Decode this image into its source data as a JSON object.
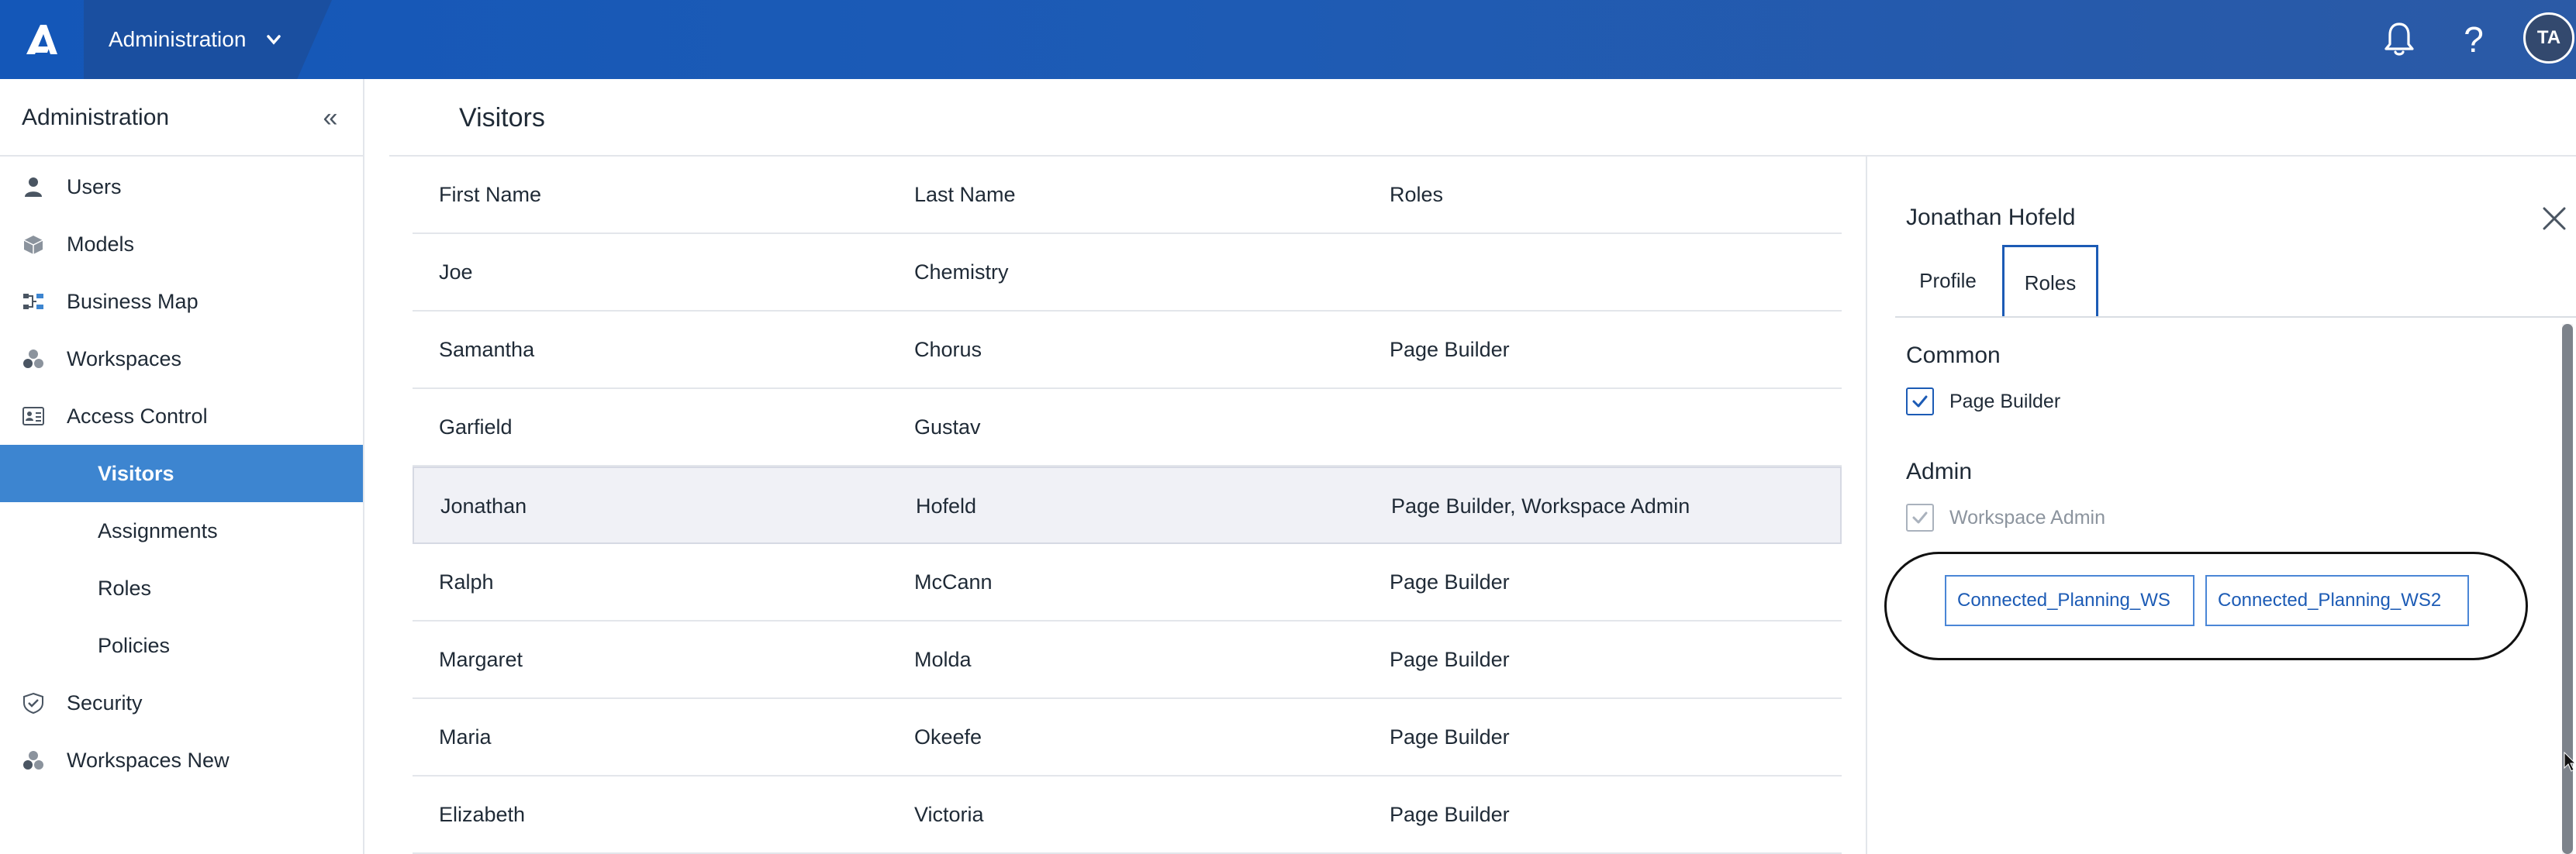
{
  "topbar": {
    "app_name": "Administration",
    "avatar_initials": "TA",
    "help_glyph": "?",
    "icons": {
      "logo": "anaplan-logo-icon",
      "notifications": "bell-icon",
      "help": "question-mark-icon",
      "switcher": "chevron-down-icon"
    }
  },
  "sidebar": {
    "title": "Administration",
    "collapse_glyph": "«",
    "items": [
      {
        "label": "Users",
        "icon": "user-icon"
      },
      {
        "label": "Models",
        "icon": "cube-icon"
      },
      {
        "label": "Business Map",
        "icon": "business-map-icon"
      },
      {
        "label": "Workspaces",
        "icon": "workspaces-icon"
      },
      {
        "label": "Access Control",
        "icon": "id-card-icon"
      },
      {
        "label": "Visitors",
        "icon": "",
        "active": true,
        "sub": true
      },
      {
        "label": "Assignments",
        "icon": "",
        "sub": true
      },
      {
        "label": "Roles",
        "icon": "",
        "sub": true
      },
      {
        "label": "Policies",
        "icon": "",
        "sub": true
      },
      {
        "label": "Security",
        "icon": "shield-check-icon"
      },
      {
        "label": "Workspaces New",
        "icon": "workspaces-icon"
      }
    ]
  },
  "main": {
    "title": "Visitors",
    "columns": [
      "First Name",
      "Last Name",
      "Roles"
    ],
    "rows": [
      {
        "first": "Joe",
        "last": "Chemistry",
        "roles": ""
      },
      {
        "first": "Samantha",
        "last": "Chorus",
        "roles": "Page Builder"
      },
      {
        "first": "Garfield",
        "last": "Gustav",
        "roles": ""
      },
      {
        "first": "Jonathan",
        "last": "Hofeld",
        "roles": "Page Builder, Workspace Admin"
      },
      {
        "first": "Ralph",
        "last": "McCann",
        "roles": "Page Builder"
      },
      {
        "first": "Margaret",
        "last": "Molda",
        "roles": "Page Builder"
      },
      {
        "first": "Maria",
        "last": "Okeefe",
        "roles": "Page Builder"
      },
      {
        "first": "Elizabeth",
        "last": "Victoria",
        "roles": "Page Builder"
      }
    ],
    "selected_row": 3
  },
  "panel": {
    "name": "Jonathan Hofeld",
    "tabs": [
      "Profile",
      "Roles"
    ],
    "active_tab": "Roles",
    "groups": [
      {
        "title": "Common",
        "items": [
          {
            "label": "Page Builder",
            "checked": true,
            "disabled": false
          }
        ]
      },
      {
        "title": "Admin",
        "items": [
          {
            "label": "Workspace Admin",
            "checked": true,
            "disabled": true
          }
        ]
      }
    ],
    "workspaces": [
      "Connected_Planning_WS",
      "Connected_Planning_WS2"
    ]
  },
  "colors": {
    "topbar": "#1d5bb5",
    "accent": "#1c5bb5",
    "active_nav": "#3d85d0",
    "selected_row": "#f0f1f6"
  }
}
